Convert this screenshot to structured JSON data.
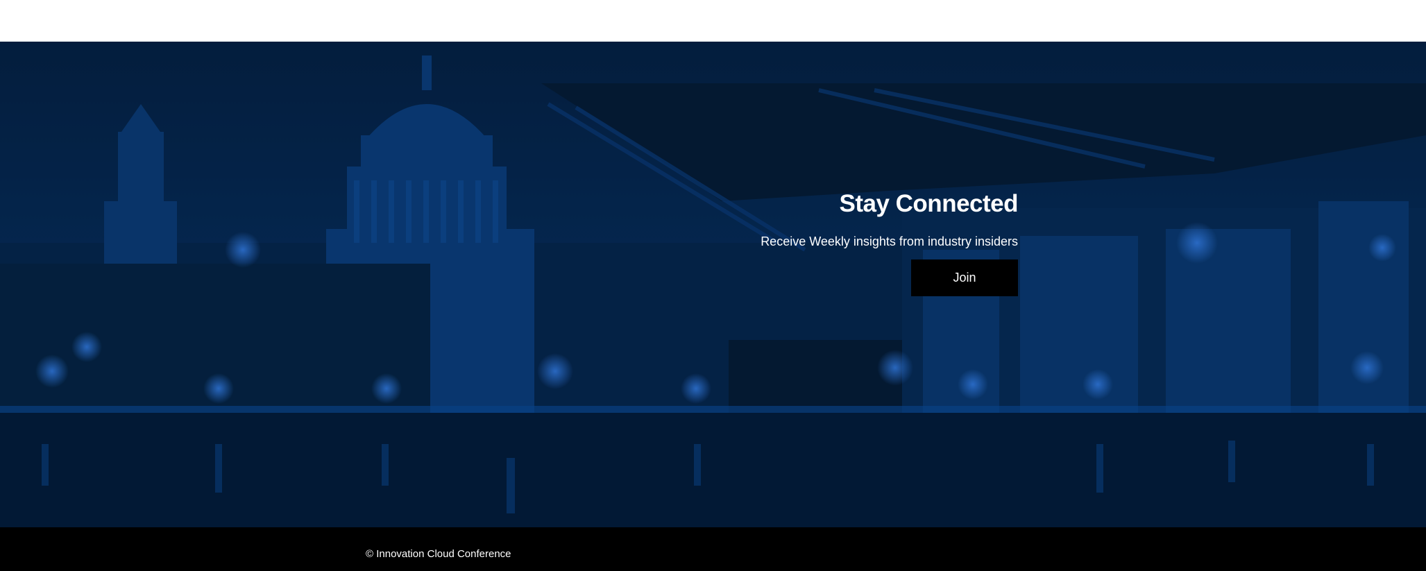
{
  "newsletter": {
    "title": "Stay Connected",
    "subtitle": "Receive Weekly insights from industry insiders",
    "join_label": "Join"
  },
  "footer": {
    "copyright": "© Innovation Cloud Conference"
  },
  "colors": {
    "hero_tint": "#06306a",
    "button_bg": "#000000",
    "footer_bg": "#000000",
    "text": "#ffffff"
  }
}
